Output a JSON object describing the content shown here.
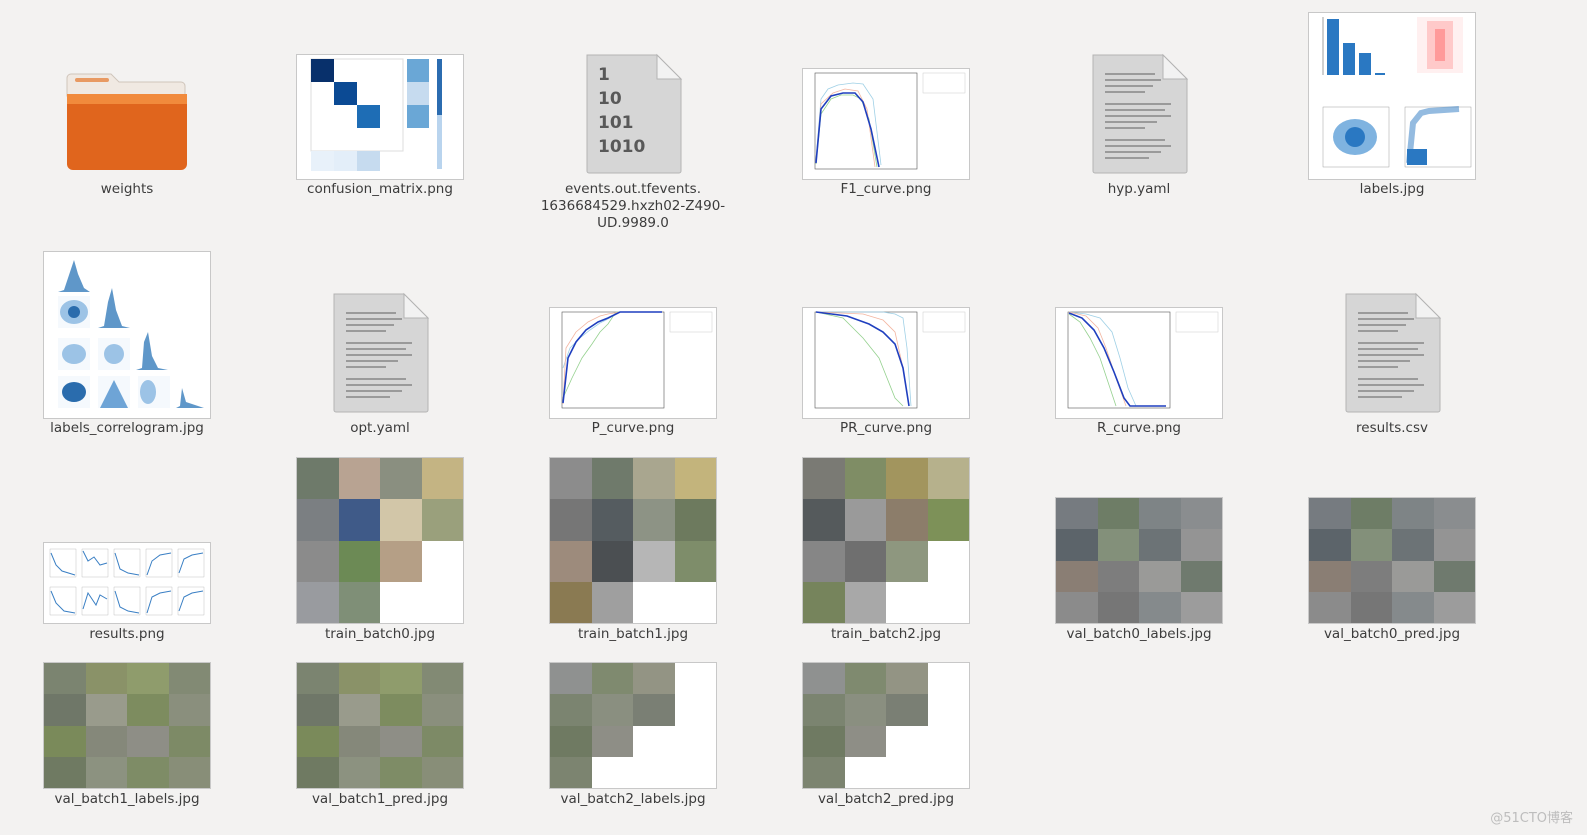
{
  "files": [
    {
      "name": "weights",
      "icon": "folder-icon"
    },
    {
      "name": "confusion_matrix.png",
      "icon": "image-thumbnail"
    },
    {
      "name": "events.out.tfevents.\n1636684529.hxzh02-Z490-\nUD.9989.0",
      "icon": "binary-file-icon"
    },
    {
      "name": "F1_curve.png",
      "icon": "image-thumbnail"
    },
    {
      "name": "hyp.yaml",
      "icon": "text-file-icon"
    },
    {
      "name": "labels.jpg",
      "icon": "image-thumbnail"
    },
    {
      "name": "labels_correlogram.jpg",
      "icon": "image-thumbnail"
    },
    {
      "name": "opt.yaml",
      "icon": "text-file-icon"
    },
    {
      "name": "P_curve.png",
      "icon": "image-thumbnail"
    },
    {
      "name": "PR_curve.png",
      "icon": "image-thumbnail"
    },
    {
      "name": "R_curve.png",
      "icon": "image-thumbnail"
    },
    {
      "name": "results.csv",
      "icon": "text-file-icon"
    },
    {
      "name": "results.png",
      "icon": "image-thumbnail"
    },
    {
      "name": "train_batch0.jpg",
      "icon": "image-thumbnail"
    },
    {
      "name": "train_batch1.jpg",
      "icon": "image-thumbnail"
    },
    {
      "name": "train_batch2.jpg",
      "icon": "image-thumbnail"
    },
    {
      "name": "val_batch0_labels.jpg",
      "icon": "image-thumbnail"
    },
    {
      "name": "val_batch0_pred.jpg",
      "icon": "image-thumbnail"
    },
    {
      "name": "val_batch1_labels.jpg",
      "icon": "image-thumbnail"
    },
    {
      "name": "val_batch1_pred.jpg",
      "icon": "image-thumbnail"
    },
    {
      "name": "val_batch2_labels.jpg",
      "icon": "image-thumbnail"
    },
    {
      "name": "val_batch2_pred.jpg",
      "icon": "image-thumbnail"
    }
  ],
  "binary_icon_lines": [
    "1",
    "10",
    "101",
    "1010"
  ],
  "watermark": "@51CTO博客",
  "colors": {
    "folder": "#e2641c",
    "folder_light": "#f29a4a",
    "chart_blue": "#1f5fbf",
    "matrix_dark": "#08306b"
  }
}
